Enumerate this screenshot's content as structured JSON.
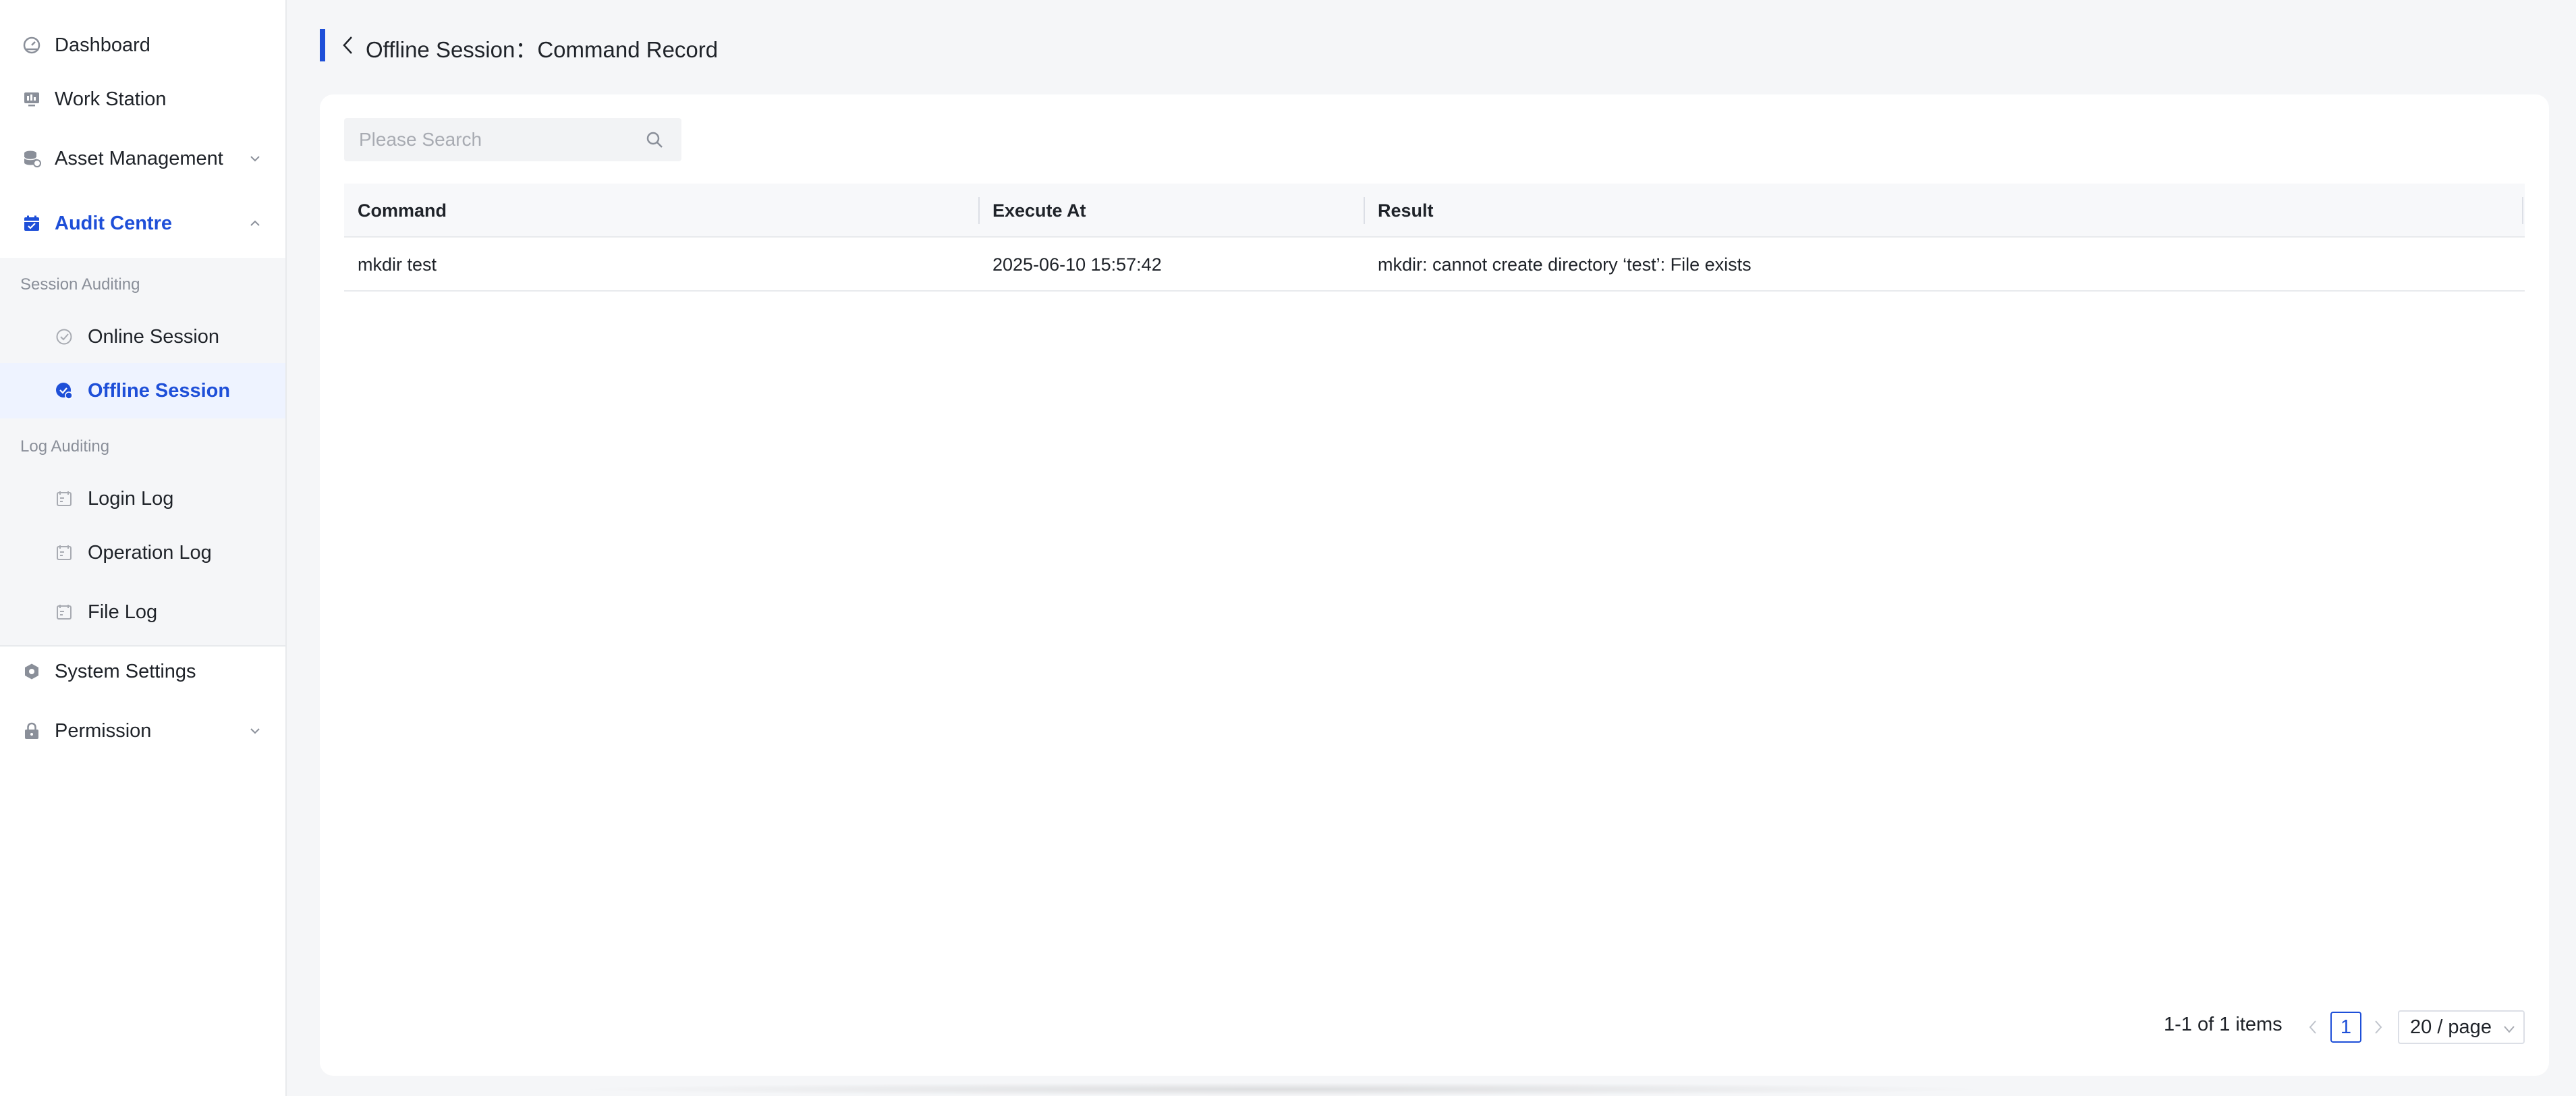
{
  "sidebar": {
    "items": [
      {
        "label": "Dashboard"
      },
      {
        "label": "Work Station"
      },
      {
        "label": "Asset Management"
      },
      {
        "label": "Audit Centre"
      },
      {
        "label": "System Settings"
      },
      {
        "label": "Permission"
      }
    ],
    "groups": {
      "session_auditing": "Session Auditing",
      "log_auditing": "Log Auditing"
    },
    "sub_items": {
      "online_session": "Online Session",
      "offline_session": "Offline Session",
      "login_log": "Login Log",
      "operation_log": "Operation Log",
      "file_log": "File Log"
    }
  },
  "header": {
    "title": "Offline Session：Command Record"
  },
  "search": {
    "placeholder": "Please Search"
  },
  "table": {
    "columns": [
      "Command",
      "Execute At",
      "Result"
    ],
    "rows": [
      {
        "command": "mkdir test",
        "execute_at": "2025-06-10 15:57:42",
        "result": "mkdir: cannot create directory ‘test’: File exists"
      }
    ]
  },
  "pagination": {
    "total_text": "1-1 of 1 items",
    "current_page": "1",
    "page_size": "20 / page"
  },
  "colors": {
    "accent": "#1e4fd8",
    "active_bg": "#eef3ff",
    "page_bg": "#f5f6f8"
  }
}
